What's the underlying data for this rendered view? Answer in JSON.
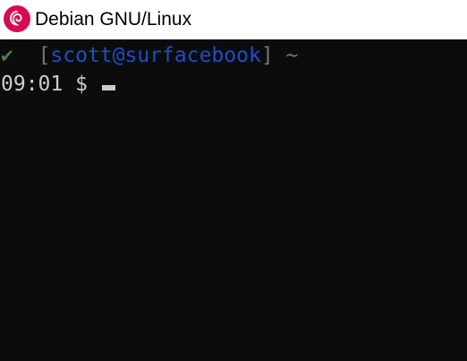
{
  "window": {
    "title": "Debian GNU/Linux",
    "icon": "debian-swirl-icon",
    "icon_color": "#d70a53"
  },
  "terminal": {
    "background": "#0c0c0c",
    "prompt": {
      "status_symbol": "✔",
      "status_color": "#4e7a4e",
      "bracket_open": "[",
      "user_host": "scott@surfacebook",
      "user_host_color": "#1f4dc8",
      "bracket_close": "]",
      "cwd": "~",
      "time": "09:01",
      "symbol": "$"
    }
  }
}
